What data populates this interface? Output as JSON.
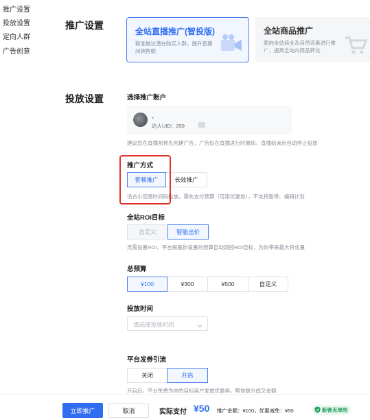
{
  "sidebar": {
    "items": [
      {
        "label": "推广设置"
      },
      {
        "label": "投放设置"
      },
      {
        "label": "定向人群"
      },
      {
        "label": "广告创意"
      }
    ]
  },
  "promo_settings": {
    "title": "推广设置",
    "cards": [
      {
        "title": "全站直播推广(智投版)",
        "desc": "精准触达潜在购买人群，提升直播间销售额",
        "icon": "video-camera-icon",
        "selected": true
      },
      {
        "title": "全站商品推广",
        "desc": "面向全站商业及自然流量进行推广，提高全站内商品转化",
        "icon": "shopping-cart-icon",
        "selected": false
      }
    ]
  },
  "delivery_settings": {
    "title": "投放设置",
    "account": {
      "label": "选择推广账户",
      "name": "、",
      "uid_label": "达人UID：259",
      "hint": "建议您在直播前预先创建广告，广告仅在直播进行时展现，直播结束后自动停止投放"
    },
    "method": {
      "label": "推广方式",
      "options": [
        "套餐推广",
        "长效推广"
      ],
      "selected": 0,
      "hint": "适合小范围时间段投放，需先支付预算（可用优惠券），不支持暂停、编辑计划"
    },
    "roi": {
      "label": "全站ROI目标",
      "options": [
        "自定义",
        "智能出价"
      ],
      "selected": 1,
      "hint": "无需设置ROI，平台根据你设置的预算自动调控ROI目标，为你带来最大转化量"
    },
    "budget": {
      "label": "总预算",
      "options": [
        "¥100",
        "¥300",
        "¥500",
        "自定义"
      ],
      "selected": 0
    },
    "time": {
      "label": "投放时间",
      "placeholder": "请选择投放时间"
    },
    "coupon": {
      "label": "平台发券引流",
      "options": [
        "关闭",
        "开启"
      ],
      "selected": 1,
      "hint": "开启后，平台免费为你的目标用户发放优惠券，帮你提升成交金额"
    }
  },
  "footer": {
    "submit_label": "立即推广",
    "cancel_label": "取消",
    "pay_label": "实际支付",
    "pay_amount": "¥50",
    "pay_detail": "推广金额：¥100，优惠减免：¥50",
    "badge": "新客无单险",
    "colors": {
      "primary": "#2f6cf0",
      "badge_green": "#1e9e5a",
      "highlight_red": "#e0312b"
    }
  }
}
